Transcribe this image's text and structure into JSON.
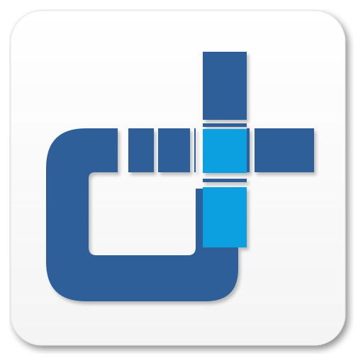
{
  "icon": {
    "name": "logo-d-plus-icon",
    "colors": {
      "tile": "#ffffff",
      "primary": "#2f5f98",
      "accent": "#0aa0e0"
    }
  }
}
